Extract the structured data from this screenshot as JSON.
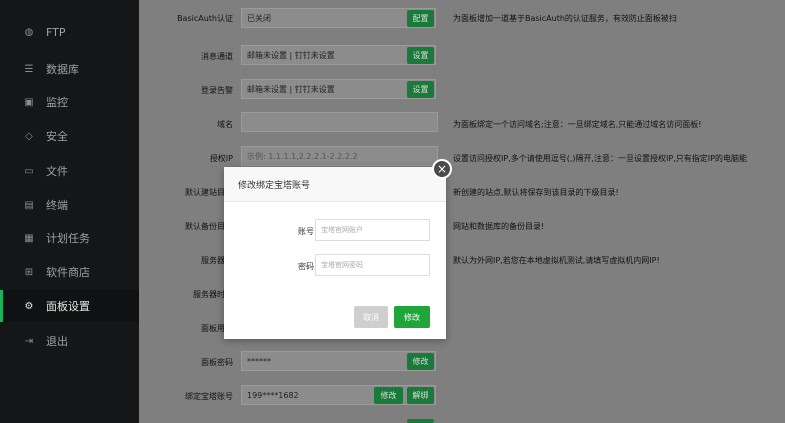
{
  "sidebar": {
    "items": [
      {
        "label": "FTP",
        "icon": "globe-icon"
      },
      {
        "label": "数据库",
        "icon": "database-icon"
      },
      {
        "label": "监控",
        "icon": "monitor-icon"
      },
      {
        "label": "安全",
        "icon": "shield-icon"
      },
      {
        "label": "文件",
        "icon": "folder-icon"
      },
      {
        "label": "终端",
        "icon": "terminal-icon"
      },
      {
        "label": "计划任务",
        "icon": "calendar-icon"
      },
      {
        "label": "软件商店",
        "icon": "grid-icon"
      },
      {
        "label": "面板设置",
        "icon": "gear-icon"
      },
      {
        "label": "退出",
        "icon": "logout-icon"
      }
    ]
  },
  "settings": {
    "basicauth": {
      "label": "BasicAuth认证",
      "value": "已关闭",
      "button": "配置",
      "hint": "为面板增加一道基于BasicAuth的认证服务，有效防止面板被扫"
    },
    "notify": {
      "label": "消息通道",
      "value": "邮箱未设置 | 钉钉未设置",
      "button": "设置"
    },
    "login_alert": {
      "label": "登录告警",
      "value": "邮箱未设置 | 钉钉未设置",
      "button": "设置"
    },
    "domain": {
      "label": "域名",
      "hint": "为面板绑定一个访问域名;注意：一旦绑定域名,只能通过域名访问面板!"
    },
    "auth_ip": {
      "label": "授权IP",
      "placeholder": "示例: 1.1.1.1,2.2.2.1-2.2.2.2",
      "hint": "设置访问授权IP,多个请使用逗号(,)隔开,注意：一旦设置授权IP,只有指定IP的电脑能"
    },
    "default_site": {
      "label": "默认建站目",
      "hint": "新创建的站点,默认将保存到该目录的下级目录!"
    },
    "default_backup": {
      "label": "默认备份目",
      "hint": "网站和数据库的备份目录!"
    },
    "server_ip": {
      "label": "服务器",
      "hint": "默认为外网IP,若您在本地虚拟机测试,请填写虚拟机内网IP!"
    },
    "server_time": {
      "label": "服务器时"
    },
    "panel_user": {
      "label": "面板用"
    },
    "panel_password": {
      "label": "面板密码",
      "value": "******",
      "button": "修改"
    },
    "bt_account": {
      "label": "绑定宝塔账号",
      "value": "199****1682",
      "button_edit": "修改",
      "button_unbind": "解绑"
    }
  },
  "modal": {
    "title": "修改绑定宝塔账号",
    "account_label": "账号",
    "account_placeholder": "宝塔官网账户",
    "password_label": "密码",
    "password_placeholder": "宝塔官网密码",
    "cancel": "取消",
    "ok": "修改",
    "close_glyph": "×"
  }
}
